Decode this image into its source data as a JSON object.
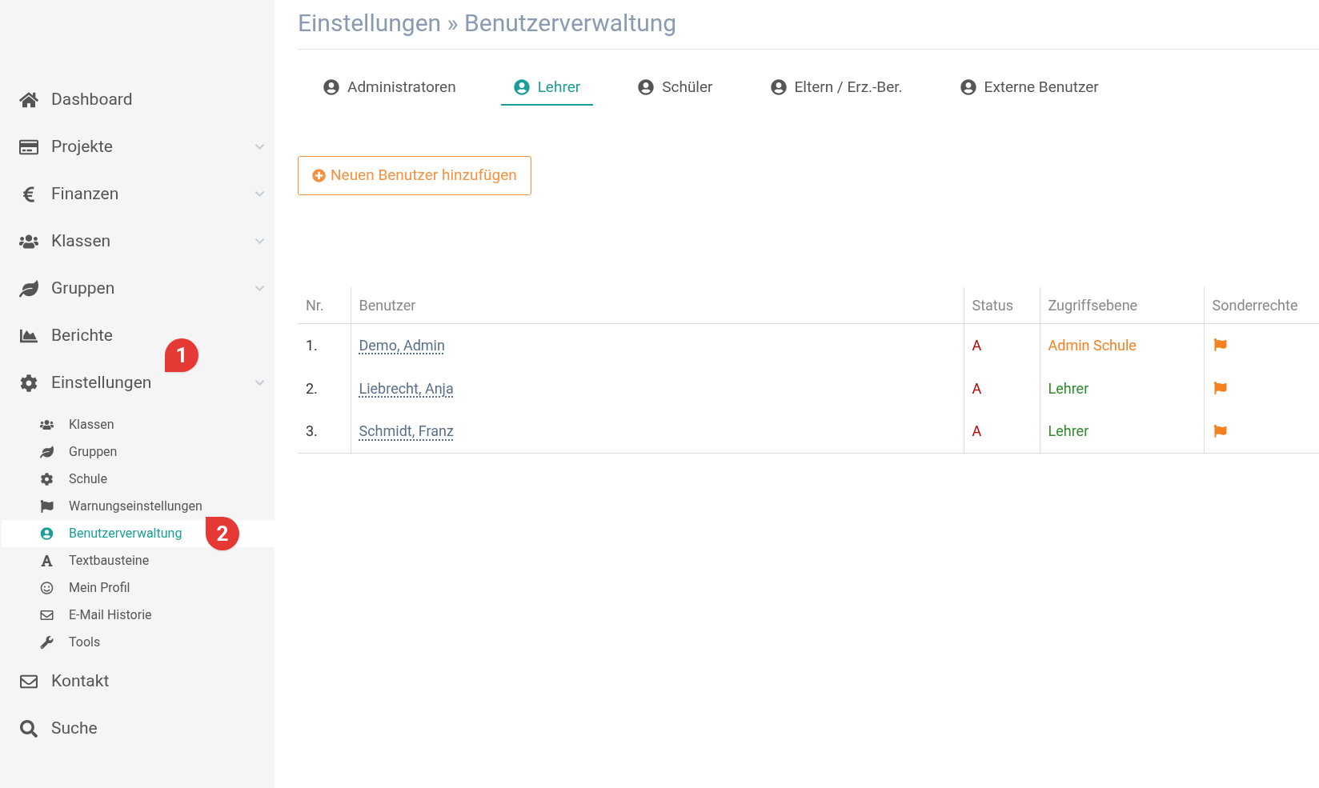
{
  "sidebar": {
    "items": [
      {
        "label": "Dashboard",
        "has_submenu": false
      },
      {
        "label": "Projekte",
        "has_submenu": true
      },
      {
        "label": "Finanzen",
        "has_submenu": true
      },
      {
        "label": "Klassen",
        "has_submenu": true
      },
      {
        "label": "Gruppen",
        "has_submenu": true
      },
      {
        "label": "Berichte",
        "has_submenu": false
      },
      {
        "label": "Einstellungen",
        "has_submenu": true,
        "badge": "1",
        "children": [
          {
            "label": "Klassen",
            "selected": false
          },
          {
            "label": "Gruppen",
            "selected": false
          },
          {
            "label": "Schule",
            "selected": false
          },
          {
            "label": "Warnungseinstellungen",
            "selected": false
          },
          {
            "label": "Benutzerverwaltung",
            "selected": true,
            "badge": "2"
          },
          {
            "label": "Textbausteine",
            "selected": false
          },
          {
            "label": "Mein Profil",
            "selected": false
          },
          {
            "label": "E-Mail Historie",
            "selected": false
          },
          {
            "label": "Tools",
            "selected": false
          }
        ]
      },
      {
        "label": "Kontakt",
        "has_submenu": false
      },
      {
        "label": "Suche",
        "has_submenu": false
      }
    ]
  },
  "breadcrumb": "Einstellungen » Benutzerverwaltung",
  "tabs": [
    {
      "label": "Administratoren",
      "selected": false
    },
    {
      "label": "Lehrer",
      "selected": true
    },
    {
      "label": "Schüler",
      "selected": false
    },
    {
      "label": "Eltern / Erz.-Ber.",
      "selected": false
    },
    {
      "label": "Externe Benutzer",
      "selected": false
    }
  ],
  "add_button": "Neuen Benutzer hinzufügen",
  "table": {
    "columns": [
      "Nr.",
      "Benutzer",
      "Status",
      "Zugriffsebene",
      "Sonderrechte"
    ],
    "rows": [
      {
        "nr": "1.",
        "user": "Demo, Admin",
        "status": "A",
        "access": "Admin Schule",
        "color": "#f58220"
      },
      {
        "nr": "2.",
        "user": "Liebrecht, Anja",
        "status": "A",
        "access": "Lehrer",
        "color": "#2e8b2e"
      },
      {
        "nr": "3.",
        "user": "Schmidt, Franz",
        "status": "A",
        "access": "Lehrer",
        "color": "#2e8b2e"
      }
    ]
  }
}
